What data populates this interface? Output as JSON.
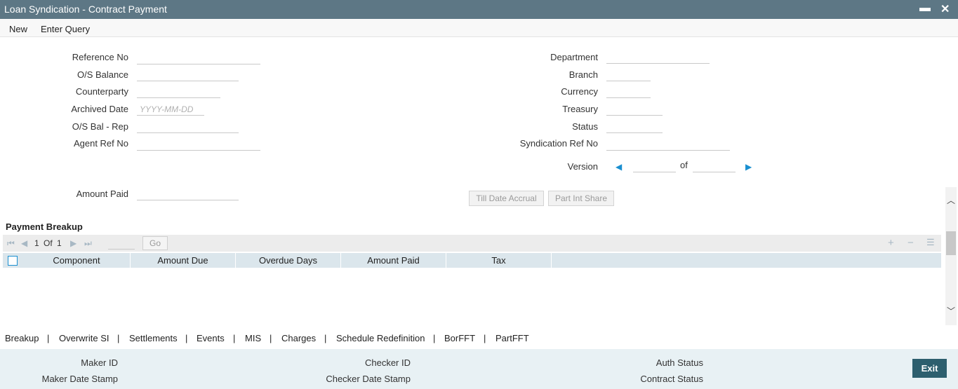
{
  "window": {
    "title": "Loan Syndication - Contract Payment",
    "minimize_glyph": "▬",
    "close_glyph": "✕"
  },
  "menu": {
    "new": "New",
    "enter_query": "Enter Query"
  },
  "form": {
    "reference_no": {
      "label": "Reference No",
      "value": ""
    },
    "os_balance": {
      "label": "O/S Balance",
      "value": ""
    },
    "counterparty": {
      "label": "Counterparty",
      "value": ""
    },
    "archived_date": {
      "label": "Archived Date",
      "value": "",
      "placeholder": "YYYY-MM-DD"
    },
    "os_bal_rep": {
      "label": "O/S Bal - Rep",
      "value": ""
    },
    "agent_ref_no": {
      "label": "Agent Ref No",
      "value": ""
    },
    "amount_paid": {
      "label": "Amount Paid",
      "value": ""
    },
    "department": {
      "label": "Department",
      "value": ""
    },
    "branch": {
      "label": "Branch",
      "value": ""
    },
    "currency": {
      "label": "Currency",
      "value": ""
    },
    "treasury": {
      "label": "Treasury",
      "value": ""
    },
    "status": {
      "label": "Status",
      "value": ""
    },
    "syndication_ref_no": {
      "label": "Syndication Ref No",
      "value": ""
    },
    "version": {
      "label": "Version",
      "of": "of",
      "value": "",
      "total": ""
    }
  },
  "buttons": {
    "till_date_accrual": "Till Date Accrual",
    "part_int_share": "Part Int Share"
  },
  "payment_breakup": {
    "title": "Payment Breakup",
    "pager": {
      "current": "1",
      "of": "Of",
      "total": "1",
      "go": "Go"
    },
    "columns": [
      "Component",
      "Amount Due",
      "Overdue Days",
      "Amount Paid",
      "Tax"
    ],
    "rows": []
  },
  "tabs": [
    "Breakup",
    "Overwrite SI",
    "Settlements",
    "Events",
    "MIS",
    "Charges",
    "Schedule Redefinition",
    "BorFFT",
    "PartFFT"
  ],
  "tab_separator": "|",
  "footer": {
    "maker_id": "Maker ID",
    "maker_date_stamp": "Maker Date Stamp",
    "checker_id": "Checker ID",
    "checker_date_stamp": "Checker Date Stamp",
    "auth_status": "Auth Status",
    "contract_status": "Contract Status",
    "exit": "Exit"
  },
  "colors": {
    "titlebar": "#5d7785",
    "accent": "#1a8fd0",
    "footer_bg": "#e8f1f4",
    "exit_button": "#2d5f6e",
    "grid_header": "#dbe6ec"
  }
}
